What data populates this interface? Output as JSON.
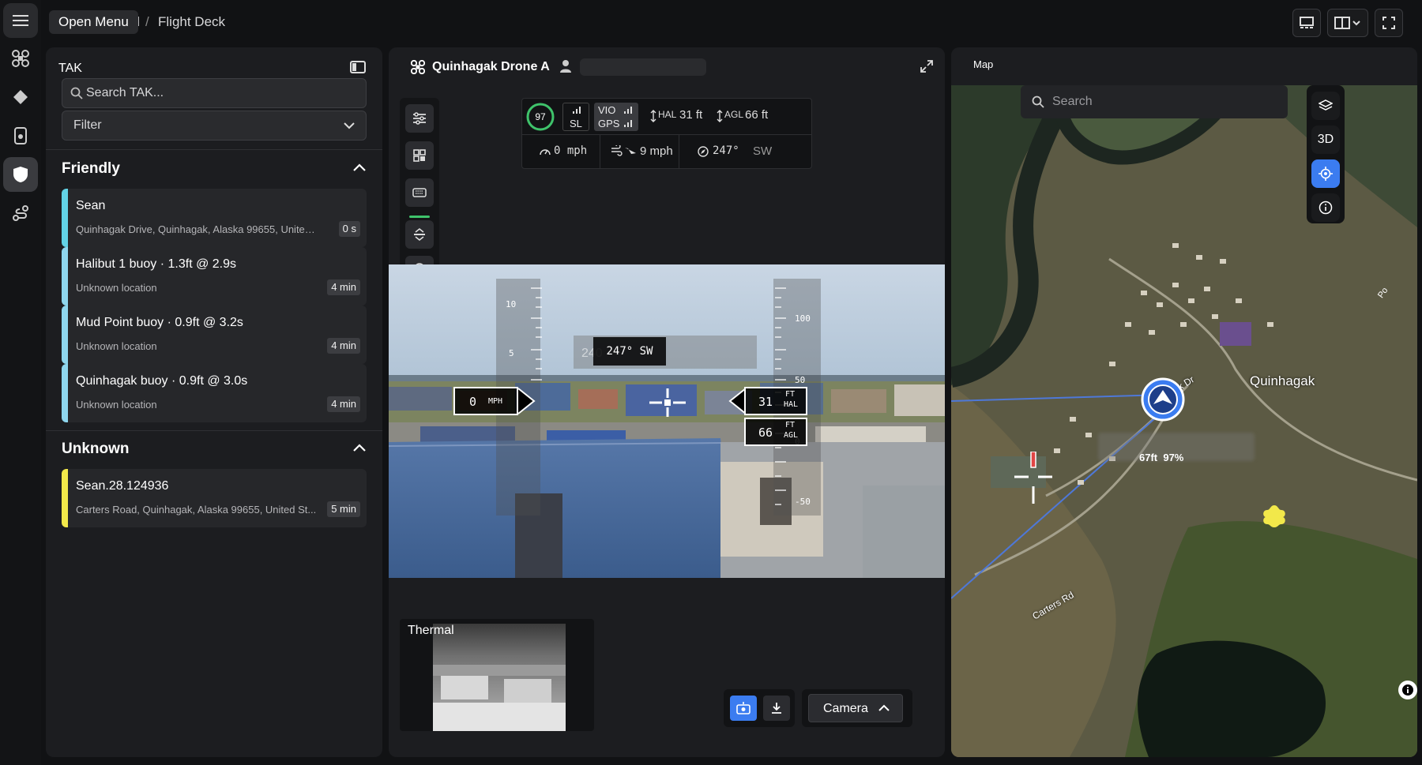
{
  "topbar": {
    "tooltip": "Open Menu",
    "crumb_parent": "nd",
    "crumb_sep": "/",
    "crumb_current": "Flight Deck"
  },
  "tak": {
    "title": "TAK",
    "search_placeholder": "Search TAK...",
    "filter_label": "Filter",
    "sections": [
      {
        "title": "Friendly",
        "items": [
          {
            "name": "Sean",
            "sub": "Quinhagak Drive, Quinhagak, Alaska 99655, United ...",
            "badge": "0 s",
            "color": "#62d3e6"
          },
          {
            "name": "Halibut 1 buoy · 1.3ft @ 2.9s",
            "sub": "Unknown location",
            "badge": "4 min",
            "color": "#8ed6ee"
          },
          {
            "name": "Mud Point buoy · 0.9ft @ 3.2s",
            "sub": "Unknown location",
            "badge": "4 min",
            "color": "#8ed6ee"
          },
          {
            "name": "Quinhagak buoy · 0.9ft @ 3.0s",
            "sub": "Unknown location",
            "badge": "4 min",
            "color": "#8ed6ee"
          }
        ]
      },
      {
        "title": "Unknown",
        "items": [
          {
            "name": "Sean.28.124936",
            "sub": "Carters Road, Quinhagak, Alaska 99655, United St...",
            "badge": "5 min",
            "color": "#f2e84a"
          }
        ]
      }
    ]
  },
  "drone": {
    "title": "Quinhagak Drone A",
    "battery": "97",
    "sl_label": "SL",
    "vio_label": "VIO",
    "gps_label": "GPS",
    "hal_label": "HAL",
    "hal_value": "31 ft",
    "agl_label": "AGL",
    "agl_value": "66 ft",
    "speed": "0 mph",
    "wind": "9 mph",
    "heading": "247°",
    "heading_dir": "SW",
    "hud": {
      "speed": "0",
      "speed_unit": "MPH",
      "heading": "247°  SW",
      "heading_ghost": "240",
      "hal": "31",
      "agl": "66",
      "ft": "FT",
      "hal_label": "HAL",
      "agl_label": "AGL",
      "left_ticks": [
        "10",
        "5"
      ],
      "right_ticks": [
        "100",
        "50",
        "0",
        "-50"
      ]
    },
    "thermal_label": "Thermal",
    "camera_label": "Camera"
  },
  "map": {
    "title": "Map",
    "search_placeholder": "Search",
    "btn_3d": "3D",
    "town_label": "Quinhagak",
    "road1": "Quinhagak Dr",
    "road2": "Carters Rd",
    "road3": "Po",
    "drone_readout": "67ft  97%"
  },
  "colors": {
    "accent": "#3b7cf0",
    "friendly": "#62d3e6",
    "unknown": "#f2e84a",
    "battery": "#3fc36b"
  }
}
